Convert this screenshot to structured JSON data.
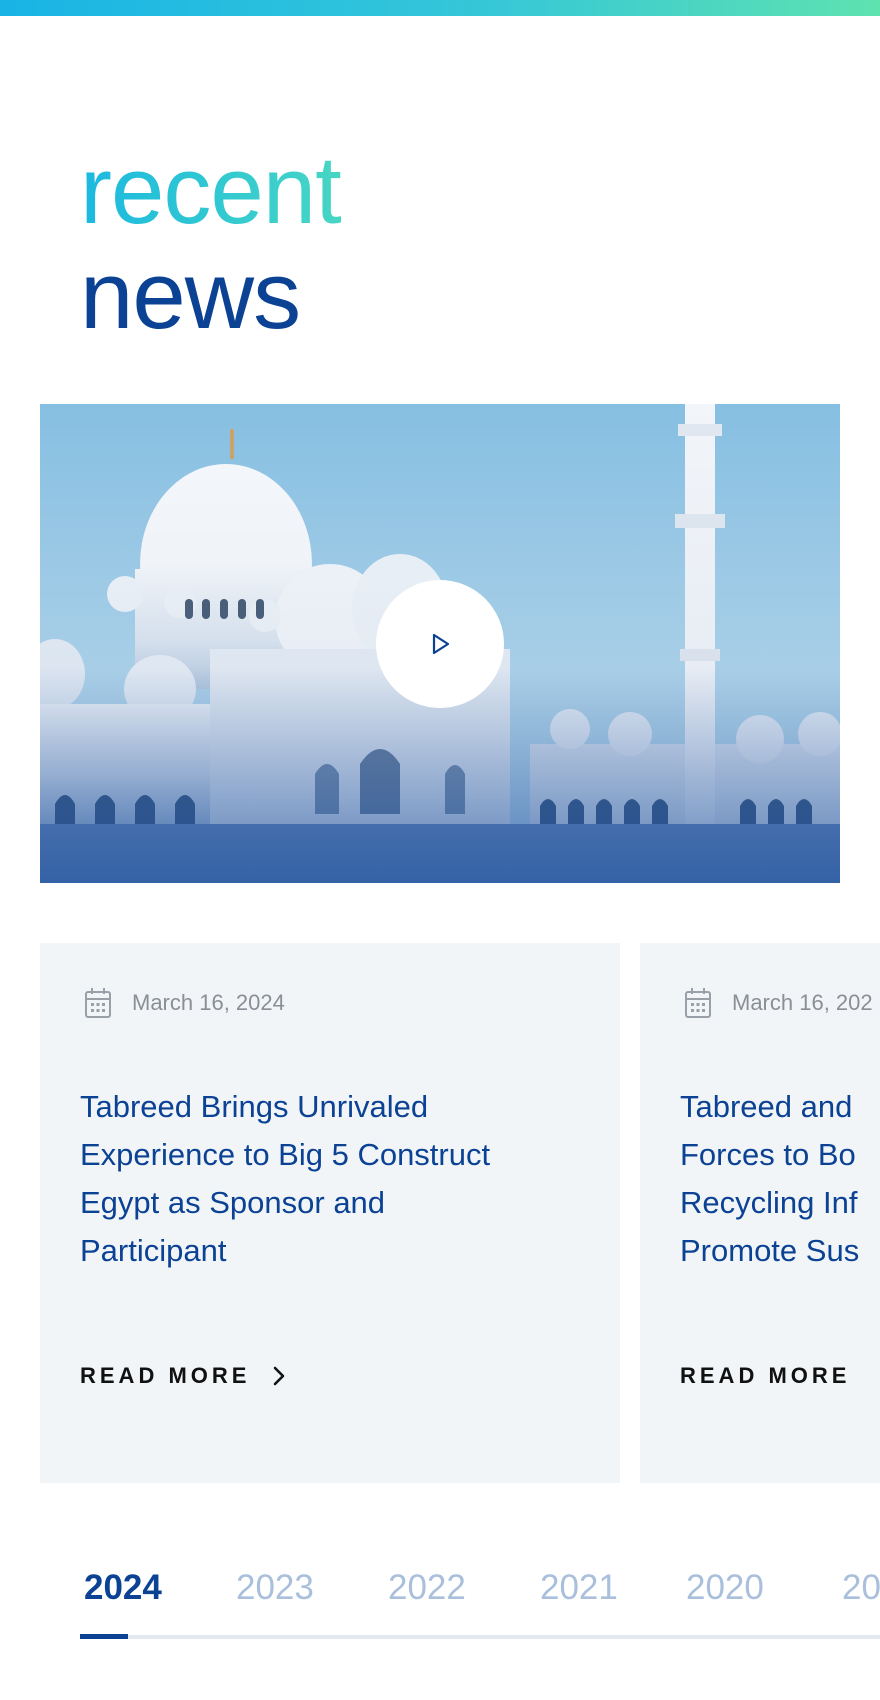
{
  "heading": {
    "line1": "recent",
    "line2": "news"
  },
  "video": {
    "play_icon": "play-icon"
  },
  "cards": [
    {
      "date": "March 16, 2024",
      "title_lines": [
        "Tabreed Brings Unrivaled",
        "Experience to Big 5 Construct",
        "Egypt as Sponsor and",
        "Participant"
      ],
      "read_more": "READ MORE",
      "date_icon": "calendar-icon",
      "arrow_icon": "chevron-right-icon"
    },
    {
      "date": "March 16, 202",
      "title_lines": [
        "Tabreed and",
        "Forces to Bo",
        "Recycling Inf",
        "Promote Sus"
      ],
      "read_more": "READ MORE",
      "date_icon": "calendar-icon"
    }
  ],
  "years": {
    "items": [
      "2024",
      "2023",
      "2022",
      "2021",
      "2020",
      "20"
    ],
    "selected": "2024"
  },
  "colors": {
    "brand_blue": "#0b4294",
    "accent_gradient_start": "#19b4e5",
    "accent_gradient_end": "#5ee2b0",
    "inactive_year": "#a9bfdc",
    "card_bg": "#f2f5f8"
  }
}
